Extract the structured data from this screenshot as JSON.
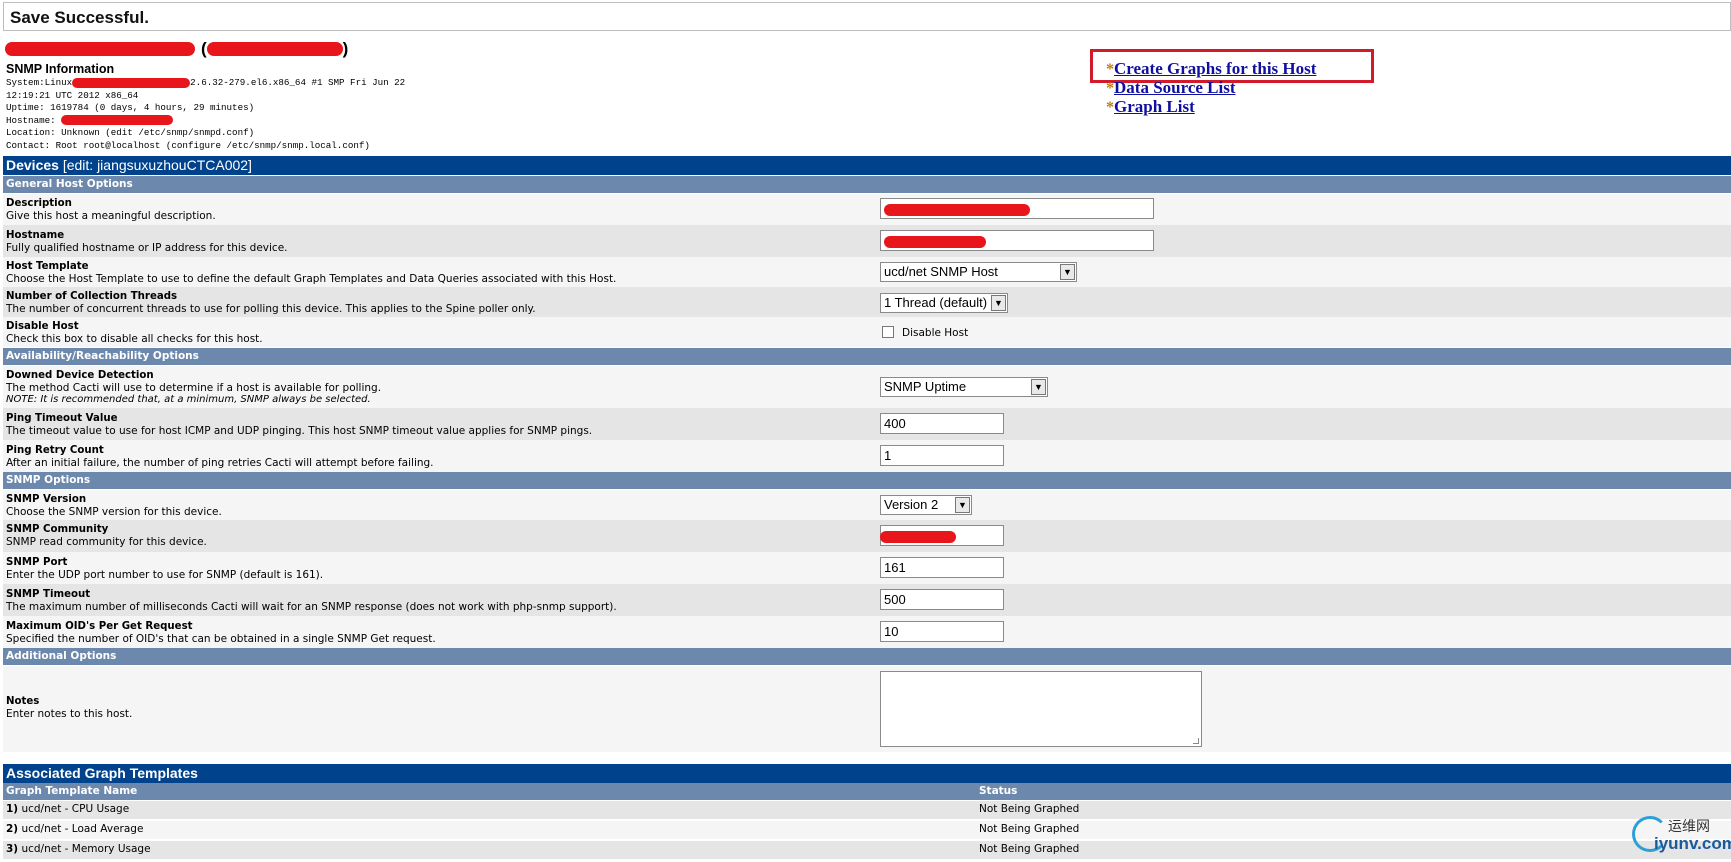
{
  "save_message": "Save Successful.",
  "host_header": {
    "open_paren": "(",
    "close_paren": ")"
  },
  "snmp": {
    "title": "SNMP Information",
    "system_prefix": "System:Linux",
    "system_suffix": "2.6.32-279.el6.x86_64 #1 SMP Fri Jun 22",
    "system_line2": "12:19:21 UTC 2012 x86_64",
    "uptime": "Uptime: 1619784 (0 days, 4 hours, 29 minutes)",
    "hostname_prefix": "Hostname:",
    "location": "Location: Unknown (edit /etc/snmp/snmpd.conf)",
    "contact": "Contact: Root root@localhost (configure /etc/snmp/snmp.local.conf)"
  },
  "links": {
    "star": "*",
    "create_graphs": "Create Graphs for this Host",
    "data_source_list": "Data Source List",
    "graph_list": "Graph List"
  },
  "devices_header": {
    "title": "Devices",
    "edit": "[edit: jiangsuxuzhouCTCA002]"
  },
  "sections": {
    "general": "General Host Options",
    "availability": "Availability/Reachability Options",
    "snmp_options": "SNMP Options",
    "additional": "Additional Options"
  },
  "fields": {
    "description": {
      "label": "Description",
      "help": "Give this host a meaningful description."
    },
    "hostname": {
      "label": "Hostname",
      "help": "Fully qualified hostname or IP address for this device."
    },
    "host_template": {
      "label": "Host Template",
      "help": "Choose the Host Template to use to define the default Graph Templates and Data Queries associated with this Host.",
      "value": "ucd/net SNMP Host"
    },
    "threads": {
      "label": "Number of Collection Threads",
      "help": "The number of concurrent threads to use for polling this device. This applies to the Spine poller only.",
      "value": "1 Thread (default)"
    },
    "disable_host": {
      "label": "Disable Host",
      "help": "Check this box to disable all checks for this host.",
      "checkbox_label": "Disable Host"
    },
    "downed_detection": {
      "label": "Downed Device Detection",
      "help": "The method Cacti will use to determine if a host is available for polling.",
      "note": "NOTE: It is recommended that, at a minimum, SNMP always be selected.",
      "value": "SNMP Uptime"
    },
    "ping_timeout": {
      "label": "Ping Timeout Value",
      "help": "The timeout value to use for host ICMP and UDP pinging. This host SNMP timeout value applies for SNMP pings.",
      "value": "400"
    },
    "ping_retry": {
      "label": "Ping Retry Count",
      "help": "After an initial failure, the number of ping retries Cacti will attempt before failing.",
      "value": "1"
    },
    "snmp_version": {
      "label": "SNMP Version",
      "help": "Choose the SNMP version for this device.",
      "value": "Version 2"
    },
    "snmp_community": {
      "label": "SNMP Community",
      "help": "SNMP read community for this device."
    },
    "snmp_port": {
      "label": "SNMP Port",
      "help": "Enter the UDP port number to use for SNMP (default is 161).",
      "value": "161"
    },
    "snmp_timeout": {
      "label": "SNMP Timeout",
      "help": "The maximum number of milliseconds Cacti will wait for an SNMP response (does not work with php-snmp support).",
      "value": "500"
    },
    "max_oids": {
      "label": "Maximum OID's Per Get Request",
      "help": "Specified the number of OID's that can be obtained in a single SNMP Get request.",
      "value": "10"
    },
    "notes": {
      "label": "Notes",
      "help": "Enter notes to this host."
    }
  },
  "graph_templates": {
    "title": "Associated Graph Templates",
    "col_name": "Graph Template Name",
    "col_status": "Status",
    "rows": [
      {
        "num": "1)",
        "name": "ucd/net - CPU Usage",
        "status": "Not Being Graphed"
      },
      {
        "num": "2)",
        "name": "ucd/net - Load Average",
        "status": "Not Being Graphed"
      },
      {
        "num": "3)",
        "name": "ucd/net - Memory Usage",
        "status": "Not Being Graphed"
      }
    ]
  },
  "watermark": {
    "cn": "运维网",
    "en": "iyunv.com"
  },
  "colors": {
    "header_dark": "#00438c",
    "header_mid": "#6d88ad",
    "row_light": "#f5f5f5",
    "row_dark": "#e5e5e5",
    "link": "#1010a0",
    "redaction": "#e8161b",
    "highlight_box": "#d11b2a"
  }
}
